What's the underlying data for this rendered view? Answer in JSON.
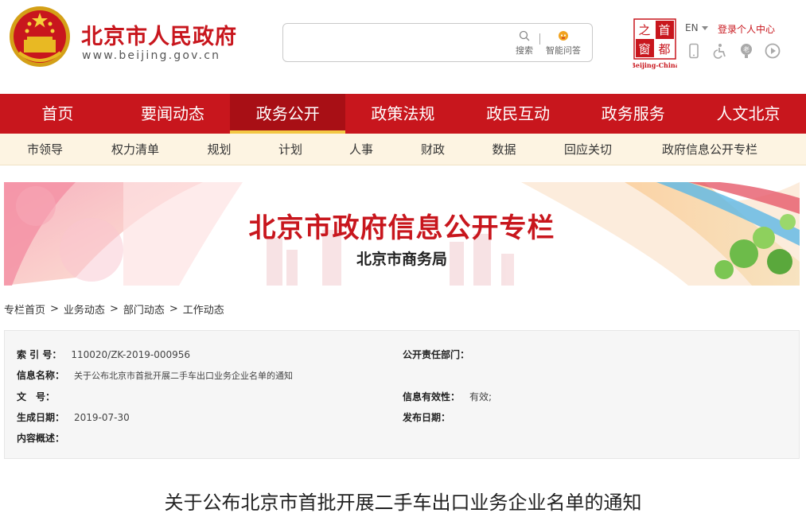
{
  "header": {
    "site_title": "北京市人民政府",
    "site_url": "www.beijing.gov.cn",
    "search": {
      "placeholder": "",
      "search_label": "搜索",
      "ask_label": "智能问答"
    },
    "capital_logo": {
      "chars": [
        "首",
        "都",
        "之",
        "窗"
      ],
      "caption": "Beijing-China"
    },
    "lang_label": "EN",
    "login_label": "登录个人中心",
    "tools": [
      "mobile-icon",
      "accessibility-icon",
      "elderly-icon",
      "audio-play-icon"
    ]
  },
  "main_nav": {
    "active_index": 2,
    "items": [
      {
        "label": "首页"
      },
      {
        "label": "要闻动态"
      },
      {
        "label": "政务公开"
      },
      {
        "label": "政策法规"
      },
      {
        "label": "政民互动"
      },
      {
        "label": "政务服务"
      },
      {
        "label": "人文北京"
      }
    ]
  },
  "sub_nav": {
    "items": [
      {
        "label": "市领导"
      },
      {
        "label": "权力清单"
      },
      {
        "label": "规划"
      },
      {
        "label": "计划"
      },
      {
        "label": "人事"
      },
      {
        "label": "财政"
      },
      {
        "label": "数据"
      },
      {
        "label": "回应关切"
      },
      {
        "label": "政府信息公开专栏"
      }
    ]
  },
  "banner": {
    "title": "北京市政府信息公开专栏",
    "subtitle": "北京市商务局"
  },
  "breadcrumb": {
    "items": [
      {
        "label": "专栏首页"
      },
      {
        "label": "业务动态"
      },
      {
        "label": "部门动态"
      },
      {
        "label": "工作动态"
      }
    ],
    "separator": ">"
  },
  "info": {
    "index_no": {
      "label": "索 引 号：",
      "value": "110020/ZK-2019-000956"
    },
    "responsible_dept": {
      "label": "公开责任部门：",
      "value": ""
    },
    "info_name": {
      "label": "信息名称：",
      "value": "关于公布北京市首批开展二手车出口业务企业名单的通知"
    },
    "doc_no": {
      "label": "文　号：",
      "value": ""
    },
    "validity": {
      "label": "信息有效性：",
      "value": "有效;"
    },
    "created_date": {
      "label": "生成日期：",
      "value": "2019-07-30"
    },
    "publish_date": {
      "label": "发布日期：",
      "value": ""
    },
    "summary": {
      "label": "内容概述：",
      "value": ""
    }
  },
  "article": {
    "title": "关于公布北京市首批开展二手车出口业务企业名单的通知"
  },
  "colors": {
    "brand_red": "#c8161d",
    "nav_active": "#a80f15",
    "nav_underline": "#f3c843",
    "subnav_bg": "#fdf4e2",
    "info_bg": "#f6f6f6"
  }
}
